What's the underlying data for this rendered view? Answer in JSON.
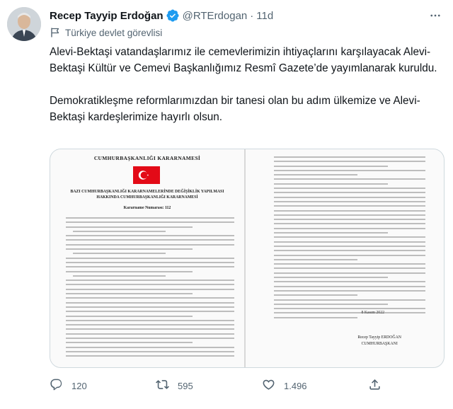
{
  "tweet": {
    "author_name": "Recep Tayyip Erdoğan",
    "handle": "@RTErdogan",
    "separator": "·",
    "time": "11d",
    "label": "Türkiye devlet görevlisi",
    "text_paragraphs": [
      "Alevi-Bektaşi vatandaşlarımız ile cemevlerimizin ihtiyaçlarını karşılayacak Alevi-Bektaşi Kültür ve Cemevi Başkanlığımız Resmî Gazete’de yayımlanarak kuruldu.",
      "Demokratikleşme reformlarımızdan bir tanesi olan bu adım ülkemize ve Alevi-Bektaşi kardeşlerimize hayırlı olsun."
    ]
  },
  "document": {
    "heading": "CUMHURBAŞKANLIĞI KARARNAMESİ",
    "title": "BAZI CUMHURBAŞKANLIĞI KARARNAMELERİNDE DEĞİŞİKLİK YAPILMASI HAKKINDA CUMHURBAŞKANLIĞI KARARNAMESİ",
    "number": "Kararname Numarası: 112",
    "date": "8 Kasım 2022",
    "signer_name": "Recep Tayyip ERDOĞAN",
    "signer_title": "CUMHURBAŞKANI"
  },
  "actions": {
    "reply_count": "120",
    "retweet_count": "595",
    "like_count": "1.496"
  },
  "colors": {
    "verified": "#1d9bf0",
    "secondary_text": "#536471",
    "flag_red": "#e30a17"
  },
  "icons": {
    "verified": "verified-badge-icon",
    "more": "more-dots-icon",
    "label": "flag-icon",
    "reply": "reply-icon",
    "retweet": "retweet-icon",
    "like": "heart-icon",
    "share": "share-icon"
  }
}
